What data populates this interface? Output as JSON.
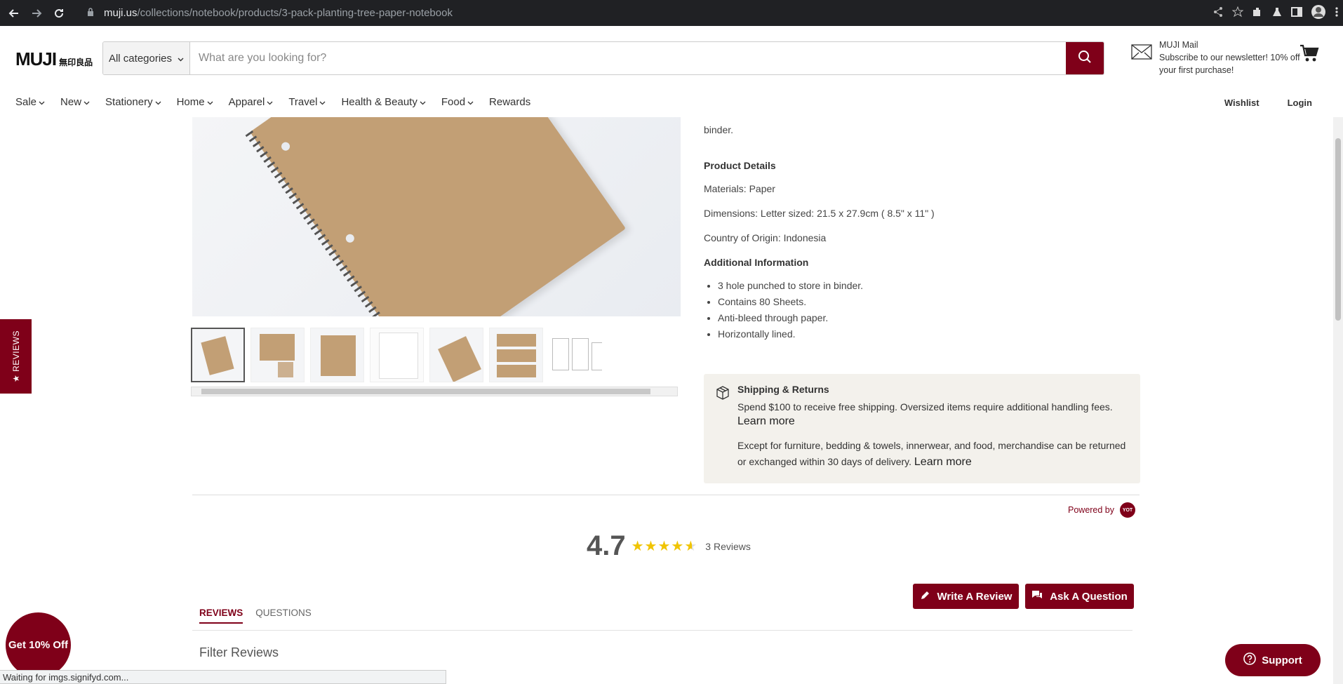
{
  "browser": {
    "url_host": "muji.us",
    "url_path": "/collections/notebook/products/3-pack-planting-tree-paper-notebook"
  },
  "header": {
    "logo_en": "MUJI",
    "logo_jp": "無印良品",
    "search": {
      "category": "All categories",
      "placeholder": "What are you looking for?"
    },
    "mail": {
      "title": "MUJI Mail",
      "text": "Subscribe to our newsletter! 10% off your first purchase!"
    }
  },
  "nav": {
    "items": [
      "Sale",
      "New",
      "Stationery",
      "Home",
      "Apparel",
      "Travel",
      "Health & Beauty",
      "Food",
      "Rewards"
    ],
    "wishlist": "Wishlist",
    "login": "Login"
  },
  "details": {
    "intro_tail": "binder.",
    "product_details_heading": "Product Details",
    "materials": "Materials: Paper",
    "dimensions": "Dimensions: Letter sized: 21.5 x 27.9cm ( 8.5\" x 11\" )",
    "origin": "Country of Origin: Indonesia",
    "additional_heading": "Additional Information",
    "bullets": [
      "3 hole punched to store in binder.",
      "Contains 80 Sheets.",
      "Anti-bleed through paper.",
      "Horizontally lined."
    ]
  },
  "shipping": {
    "title": "Shipping & Returns",
    "line1": "Spend $100 to receive free shipping. Oversized items require additional handling fees.",
    "learn1": "Learn more",
    "line2": "Except for furniture, bedding & towels, innerwear, and food, merchandise can be returned or exchanged within 30 days of delivery.",
    "learn2": "Learn more"
  },
  "reviews": {
    "powered_by": "Powered by",
    "rating": "4.7",
    "rating_value": 4.7,
    "count": "3 Reviews",
    "write": "Write A Review",
    "ask": "Ask A Question",
    "tab_reviews": "REVIEWS",
    "tab_questions": "QUESTIONS",
    "filter": "Filter Reviews"
  },
  "floating": {
    "reviews_tab": "★ REVIEWS",
    "promo": "Get 10% Off",
    "support": "Support",
    "status": "Waiting for imgs.signifyd.com..."
  },
  "colors": {
    "brand": "#7f0019",
    "star": "#f0c400"
  }
}
